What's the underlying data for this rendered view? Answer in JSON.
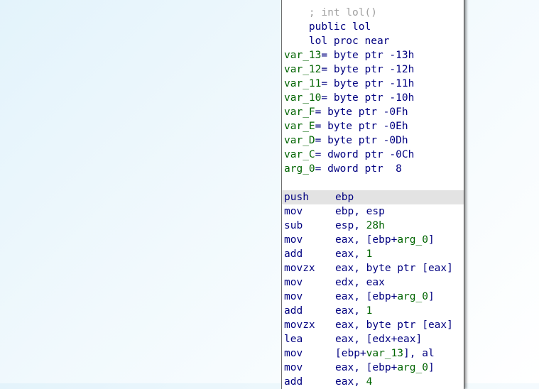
{
  "header": {
    "comment": "; int lol()",
    "public_line": "public lol",
    "proc_line": "lol proc near"
  },
  "locals": [
    {
      "name": "var_13",
      "def": "= byte ptr -13h"
    },
    {
      "name": "var_12",
      "def": "= byte ptr -12h"
    },
    {
      "name": "var_11",
      "def": "= byte ptr -11h"
    },
    {
      "name": "var_10",
      "def": "= byte ptr -10h"
    },
    {
      "name": "var_F",
      "def": "= byte ptr -0Fh"
    },
    {
      "name": "var_E",
      "def": "= byte ptr -0Eh"
    },
    {
      "name": "var_D",
      "def": "= byte ptr -0Dh"
    },
    {
      "name": "var_C",
      "def": "= dword ptr -0Ch"
    },
    {
      "name": "arg_0",
      "def": "= dword ptr  8"
    }
  ],
  "instructions": [
    {
      "mnemonic": "push",
      "op_a": "ebp",
      "op_var": "",
      "op_b": "",
      "highlighted": true
    },
    {
      "mnemonic": "mov",
      "op_a": "ebp, esp",
      "op_var": "",
      "op_b": ""
    },
    {
      "mnemonic": "sub",
      "op_a": "esp, ",
      "op_var": "28h",
      "op_b": ""
    },
    {
      "mnemonic": "mov",
      "op_a": "eax, [ebp+",
      "op_var": "arg_0",
      "op_b": "]"
    },
    {
      "mnemonic": "add",
      "op_a": "eax, ",
      "op_var": "1",
      "op_b": ""
    },
    {
      "mnemonic": "movzx",
      "op_a": "eax, byte ptr [eax]",
      "op_var": "",
      "op_b": ""
    },
    {
      "mnemonic": "mov",
      "op_a": "edx, eax",
      "op_var": "",
      "op_b": ""
    },
    {
      "mnemonic": "mov",
      "op_a": "eax, [ebp+",
      "op_var": "arg_0",
      "op_b": "]"
    },
    {
      "mnemonic": "add",
      "op_a": "eax, ",
      "op_var": "1",
      "op_b": ""
    },
    {
      "mnemonic": "movzx",
      "op_a": "eax, byte ptr [eax]",
      "op_var": "",
      "op_b": ""
    },
    {
      "mnemonic": "lea",
      "op_a": "eax, [edx+eax]",
      "op_var": "",
      "op_b": ""
    },
    {
      "mnemonic": "mov",
      "op_a": "[ebp+",
      "op_var": "var_13",
      "op_b": "], al"
    },
    {
      "mnemonic": "mov",
      "op_a": "eax, [ebp+",
      "op_var": "arg_0",
      "op_b": "]"
    },
    {
      "mnemonic": "add",
      "op_a": "eax, ",
      "op_var": "4",
      "op_b": ""
    }
  ],
  "colors": {
    "keyword": "#000080",
    "name": "#006400",
    "number": "#008000",
    "comment": "#a0a0a0",
    "highlight": "#e3e3e3"
  }
}
